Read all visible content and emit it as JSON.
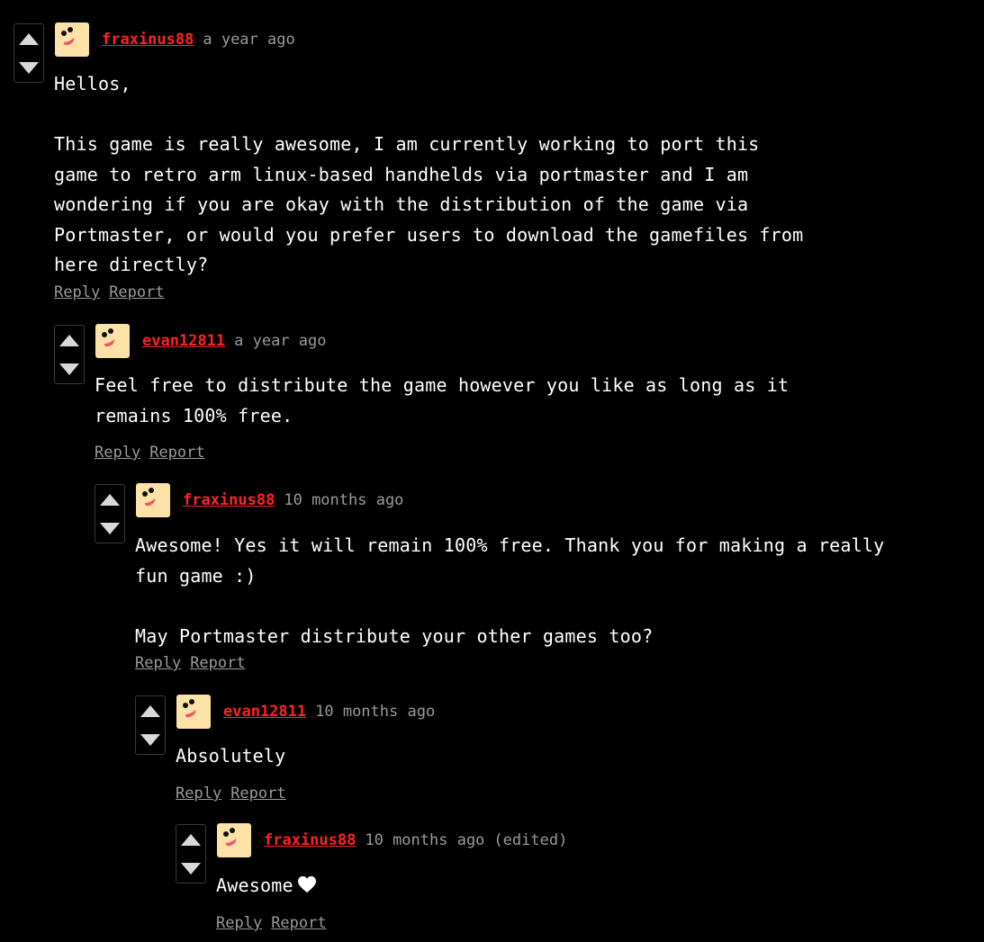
{
  "colors": {
    "background": "#000000",
    "username": "#ff2222",
    "muted": "#9a9a9a",
    "text": "#ffffff",
    "avatar_bg": "#fde2a7"
  },
  "icons": {
    "upvote": "triangle-up-icon",
    "downvote": "triangle-down-icon",
    "heart": "white-heart-icon"
  },
  "comments": [
    {
      "username": "fraxinus88",
      "time": "a year ago",
      "body": "Hellos,\n\nThis game is really awesome, I am currently working to port this\ngame to retro arm linux-based handhelds via portmaster and I am\nwondering if you are okay with the distribution of the game via\nPortmaster, or would you prefer users to download the gamefiles from\nhere directly?",
      "reply": "Reply",
      "report": "Report"
    },
    {
      "username": "evan12811",
      "time": "a year ago",
      "body": "Feel free to distribute the game however you like as long as it\nremains 100% free.",
      "reply": "Reply",
      "report": "Report"
    },
    {
      "username": "fraxinus88",
      "time": "10 months ago",
      "body": "Awesome! Yes it will remain 100% free. Thank you for making a really\nfun game :)\n\nMay Portmaster distribute your other games too?",
      "reply": "Reply",
      "report": "Report"
    },
    {
      "username": "evan12811",
      "time": "10 months ago",
      "body": "Absolutely",
      "reply": "Reply",
      "report": "Report"
    },
    {
      "username": "fraxinus88",
      "time": "10 months ago",
      "edited": "(edited)",
      "body": "Awesome",
      "reply": "Reply",
      "report": "Report"
    }
  ]
}
